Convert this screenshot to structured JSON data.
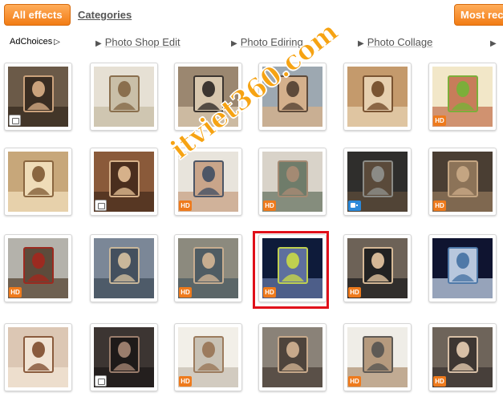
{
  "top_bar": {
    "all_effects_label": "All effects",
    "categories_label": "Categories",
    "most_recent_label": "Most rec"
  },
  "ads": {
    "adchoices_label": "AdChoices",
    "links": [
      "Photo Shop Edit",
      "Photo Ediring",
      "Photo Collage",
      ""
    ]
  },
  "thumbnails": [
    {
      "badge": "camera"
    },
    {
      "badge": ""
    },
    {
      "badge": ""
    },
    {
      "badge": ""
    },
    {
      "badge": ""
    },
    {
      "badge": "HD"
    },
    {
      "badge": ""
    },
    {
      "badge": "camera"
    },
    {
      "badge": "HD"
    },
    {
      "badge": "HD"
    },
    {
      "badge": "video"
    },
    {
      "badge": "HD"
    },
    {
      "badge": "HD"
    },
    {
      "badge": ""
    },
    {
      "badge": "HD"
    },
    {
      "badge": "HD"
    },
    {
      "badge": "HD"
    },
    {
      "badge": ""
    },
    {
      "badge": ""
    },
    {
      "badge": "camera"
    },
    {
      "badge": "HD"
    },
    {
      "badge": ""
    },
    {
      "badge": "HD"
    },
    {
      "badge": "HD"
    }
  ],
  "hd_label": "HD",
  "watermark": "itviet360.com",
  "colors": {
    "accent": "#f27c14",
    "highlight": "#e0101a",
    "watermark": "#f6a313"
  }
}
